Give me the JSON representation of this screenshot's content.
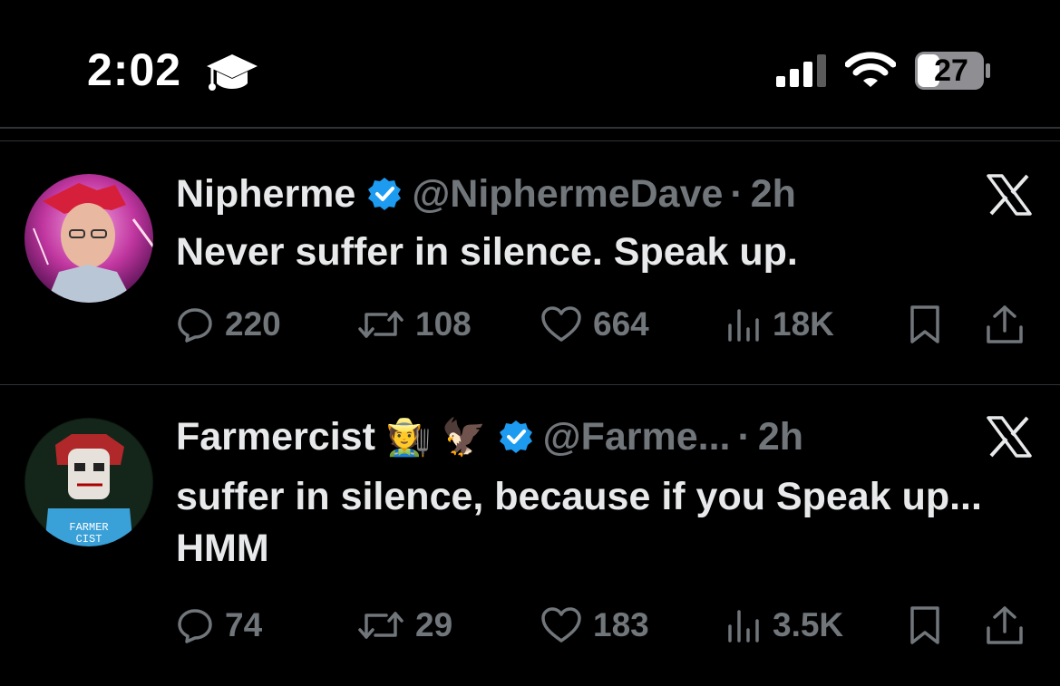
{
  "status_bar": {
    "time": "2:02",
    "battery_level": "27"
  },
  "tweets": [
    {
      "name": "Nipherme",
      "emojis": "",
      "handle": "@NiphermeDave",
      "separator": "·",
      "time_ago": "2h",
      "text": "Never suffer in silence. Speak up.",
      "replies": "220",
      "reposts": "108",
      "likes": "664",
      "views": "18K"
    },
    {
      "name": "Farmercist",
      "emojis": "🧑‍🌾 🦅",
      "handle": "@Farme...",
      "separator": "·",
      "time_ago": "2h",
      "text": "suffer in silence, because if you Speak up... HMM",
      "replies": "74",
      "reposts": "29",
      "likes": "183",
      "views": "3.5K"
    }
  ],
  "colors": {
    "background": "#000000",
    "primary_text": "#e7e9ea",
    "secondary_text": "#71767b",
    "verified_blue": "#1d9bf0",
    "divider": "#2f3336"
  }
}
